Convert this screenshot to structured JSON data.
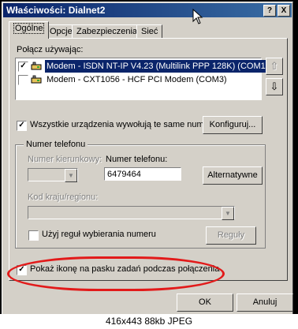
{
  "window": {
    "title": "Właściwości: Dialnet2",
    "help_btn": "?",
    "close_btn": "X"
  },
  "tabs": [
    {
      "label": "Ogólne",
      "active": true
    },
    {
      "label": "Opcje",
      "active": false
    },
    {
      "label": "Zabezpieczenia",
      "active": false
    },
    {
      "label": "Sieć",
      "active": false
    }
  ],
  "connect_using": {
    "label": "Połącz używając:",
    "devices": [
      {
        "text": "Modem - ISDN NT-IP V4.23 (Multilink PPP 128K) (COM1)",
        "checked": true,
        "selected": true
      },
      {
        "text": "Modem - CXT1056 - HCF PCI Modem (COM3)",
        "checked": false,
        "selected": false
      }
    ],
    "up_arrow": "⇧",
    "down_arrow": "⇩"
  },
  "all_devices": {
    "label": "Wszystkie urządzenia wywołują te same numery",
    "checked": true,
    "configure_btn": "Konfiguruj..."
  },
  "phone": {
    "group_label": "Numer telefonu",
    "area_code_label": "Numer kierunkowy:",
    "phone_label": "Numer telefonu:",
    "phone_value": "6479464",
    "alternates_btn": "Alternatywne",
    "country_label": "Kod kraju/regionu:",
    "dialing_rules_label": "Użyj reguł wybierania numeru",
    "rules_btn": "Reguły"
  },
  "show_icon": {
    "label": "Pokaż ikonę na pasku zadań podczas połączenia",
    "checked": true
  },
  "buttons": {
    "ok": "OK",
    "cancel": "Anuluj"
  },
  "footer_caption": "416x443 88kb JPEG",
  "colors": {
    "title_bar": "#0a246a",
    "selection": "#0a246a",
    "highlight_ellipse": "#e21a1a",
    "dialog_bg": "#d4d0c8"
  }
}
